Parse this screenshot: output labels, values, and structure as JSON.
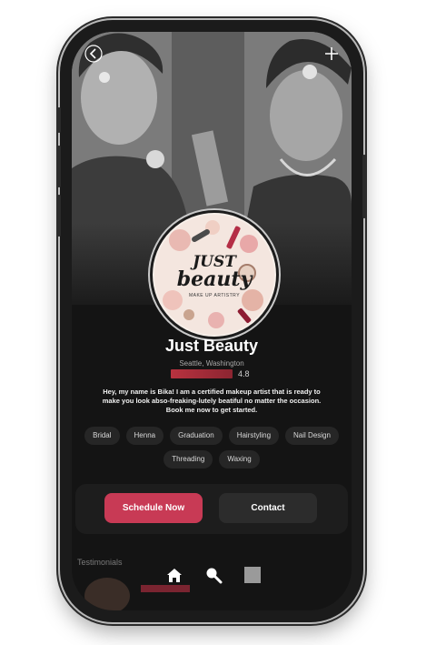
{
  "colors": {
    "accent": "#c83a55",
    "rating": "#b8323f",
    "background": "#141414",
    "chip": "#262626"
  },
  "header": {
    "back_icon": "chevron-left-icon",
    "add_icon": "plus-icon"
  },
  "profile": {
    "logo_line1": "JUST",
    "logo_line2": "beauty",
    "logo_line3": "MAKE UP ARTISTRY",
    "name": "Just Beauty",
    "location": "Seattle, Washington",
    "rating": "4.8",
    "bio": "Hey, my name is Bika! I am a certified makeup artist that is ready to make you look abso-freaking-lutely beatiful no matter the occasion. Book me now to get started."
  },
  "services": [
    "Bridal",
    "Henna",
    "Graduation",
    "Hairstyling",
    "Nail Design",
    "Threading",
    "Waxing"
  ],
  "actions": {
    "schedule_label": "Schedule Now",
    "contact_label": "Contact"
  },
  "sections": {
    "testimonials_title": "Testimonials"
  },
  "nav": {
    "items": [
      "home-icon",
      "search-icon",
      "square-icon"
    ]
  }
}
